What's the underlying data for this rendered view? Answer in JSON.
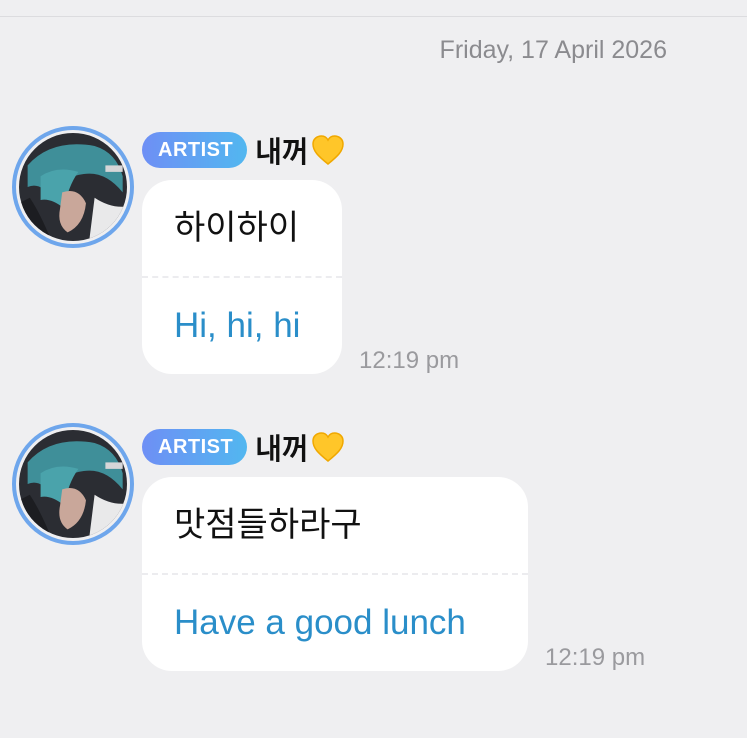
{
  "date_separator": "Friday, 17 April 2026",
  "messages": [
    {
      "badge": "ARTIST",
      "sender_name": "내꺼",
      "name_icon": "yellow-heart-icon",
      "original_text": "하이하이",
      "translated_text": "Hi, hi, hi",
      "time": "12:19 pm"
    },
    {
      "badge": "ARTIST",
      "sender_name": "내꺼",
      "name_icon": "yellow-heart-icon",
      "original_text": "맛점들하라구",
      "translated_text": "Have a good lunch",
      "time": "12:19 pm"
    }
  ],
  "colors": {
    "background": "#efeff1",
    "badge_gradient_start": "#6e8ff5",
    "badge_gradient_end": "#52b7f0",
    "translation_text": "#2a8ec9",
    "avatar_ring": "#6ea6ec",
    "heart": "#ffc629"
  }
}
